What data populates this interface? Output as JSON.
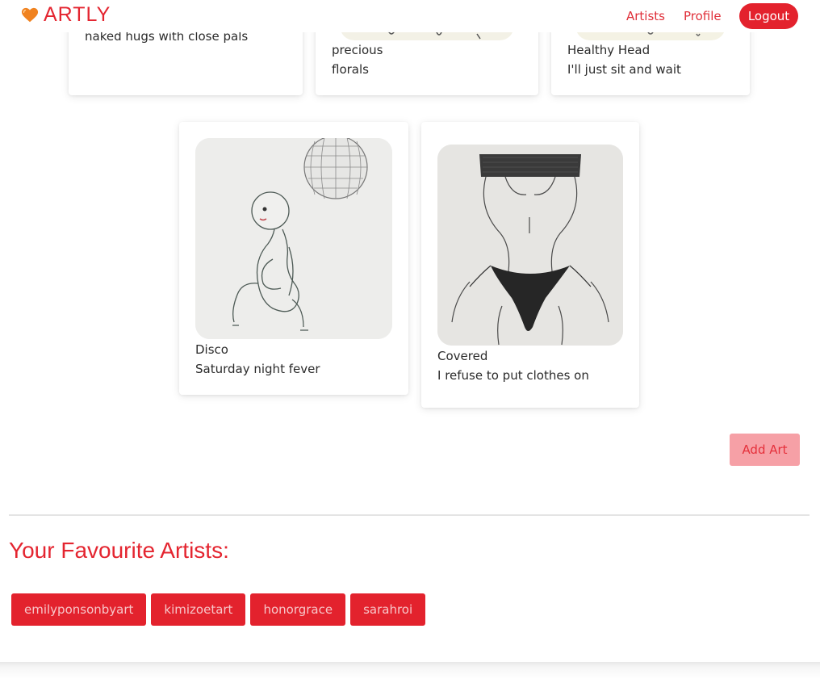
{
  "nav": {
    "brand": "ARTLY",
    "links": [
      "Artists",
      "Profile"
    ],
    "logout": "Logout"
  },
  "top_cards": [
    {
      "text": "naked hugs with close pals"
    },
    {
      "title": "precious",
      "text": "florals"
    },
    {
      "title": "Healthy Head",
      "text": "I'll just sit and wait"
    }
  ],
  "art_cards": [
    {
      "title": "Disco",
      "text": "Saturday night fever"
    },
    {
      "title": "Covered",
      "text": "I refuse to put clothes on"
    }
  ],
  "add_art_label": "Add Art",
  "favourites": {
    "heading": "Your Favourite Artists:",
    "artists": [
      "emilyponsonbyart",
      "kimizoetart",
      "honorgrace",
      "sarahroi"
    ]
  },
  "colors": {
    "brand": "#e42530",
    "button": "#e3222d",
    "add_art_bg": "#f6a0a6"
  }
}
